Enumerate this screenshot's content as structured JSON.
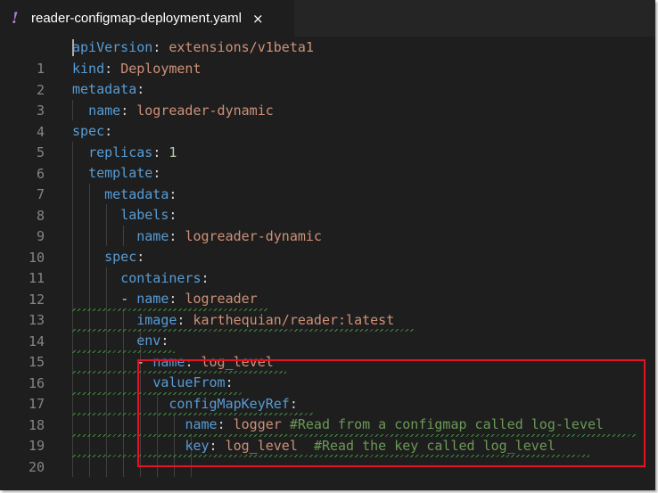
{
  "tab": {
    "icon": "!",
    "title": "reader-configmap-deployment.yaml",
    "close": "×"
  },
  "lines": [
    {
      "num": "1",
      "key": "apiVersion",
      "val": "extensions/v1beta1"
    },
    {
      "num": "2",
      "key": "kind",
      "val": "Deployment"
    },
    {
      "num": "3",
      "key": "metadata",
      "val": ""
    },
    {
      "num": "4",
      "key": "name",
      "val": "logreader-dynamic"
    },
    {
      "num": "5",
      "key": "spec",
      "val": ""
    },
    {
      "num": "6",
      "key": "replicas",
      "val": "1"
    },
    {
      "num": "7",
      "key": "template",
      "val": ""
    },
    {
      "num": "8",
      "key": "metadata",
      "val": ""
    },
    {
      "num": "9",
      "key": "labels",
      "val": ""
    },
    {
      "num": "10",
      "key": "name",
      "val": "logreader-dynamic"
    },
    {
      "num": "11",
      "key": "spec",
      "val": ""
    },
    {
      "num": "12",
      "key": "containers",
      "val": ""
    },
    {
      "num": "13",
      "key": "name",
      "val": "logreader"
    },
    {
      "num": "14",
      "key": "image",
      "val": "karthequian/reader:latest"
    },
    {
      "num": "15",
      "key": "env",
      "val": ""
    },
    {
      "num": "16",
      "key": "name",
      "val": "log_level"
    },
    {
      "num": "17",
      "key": "valueFrom",
      "val": ""
    },
    {
      "num": "18",
      "key": "configMapKeyRef",
      "val": ""
    },
    {
      "num": "19",
      "key": "name",
      "val": "logger",
      "comment": "#Read from a configmap called log-level"
    },
    {
      "num": "20",
      "key": "key",
      "val": "log_level",
      "comment": "#Read the key called log_level"
    }
  ],
  "dash": "- ",
  "colon": ":",
  "colors": {
    "background": "#1e1e1e",
    "key": "#569cd6",
    "string": "#ce9178",
    "number": "#b5cea8",
    "comment": "#6a9955",
    "highlight_box": "#e81123"
  }
}
